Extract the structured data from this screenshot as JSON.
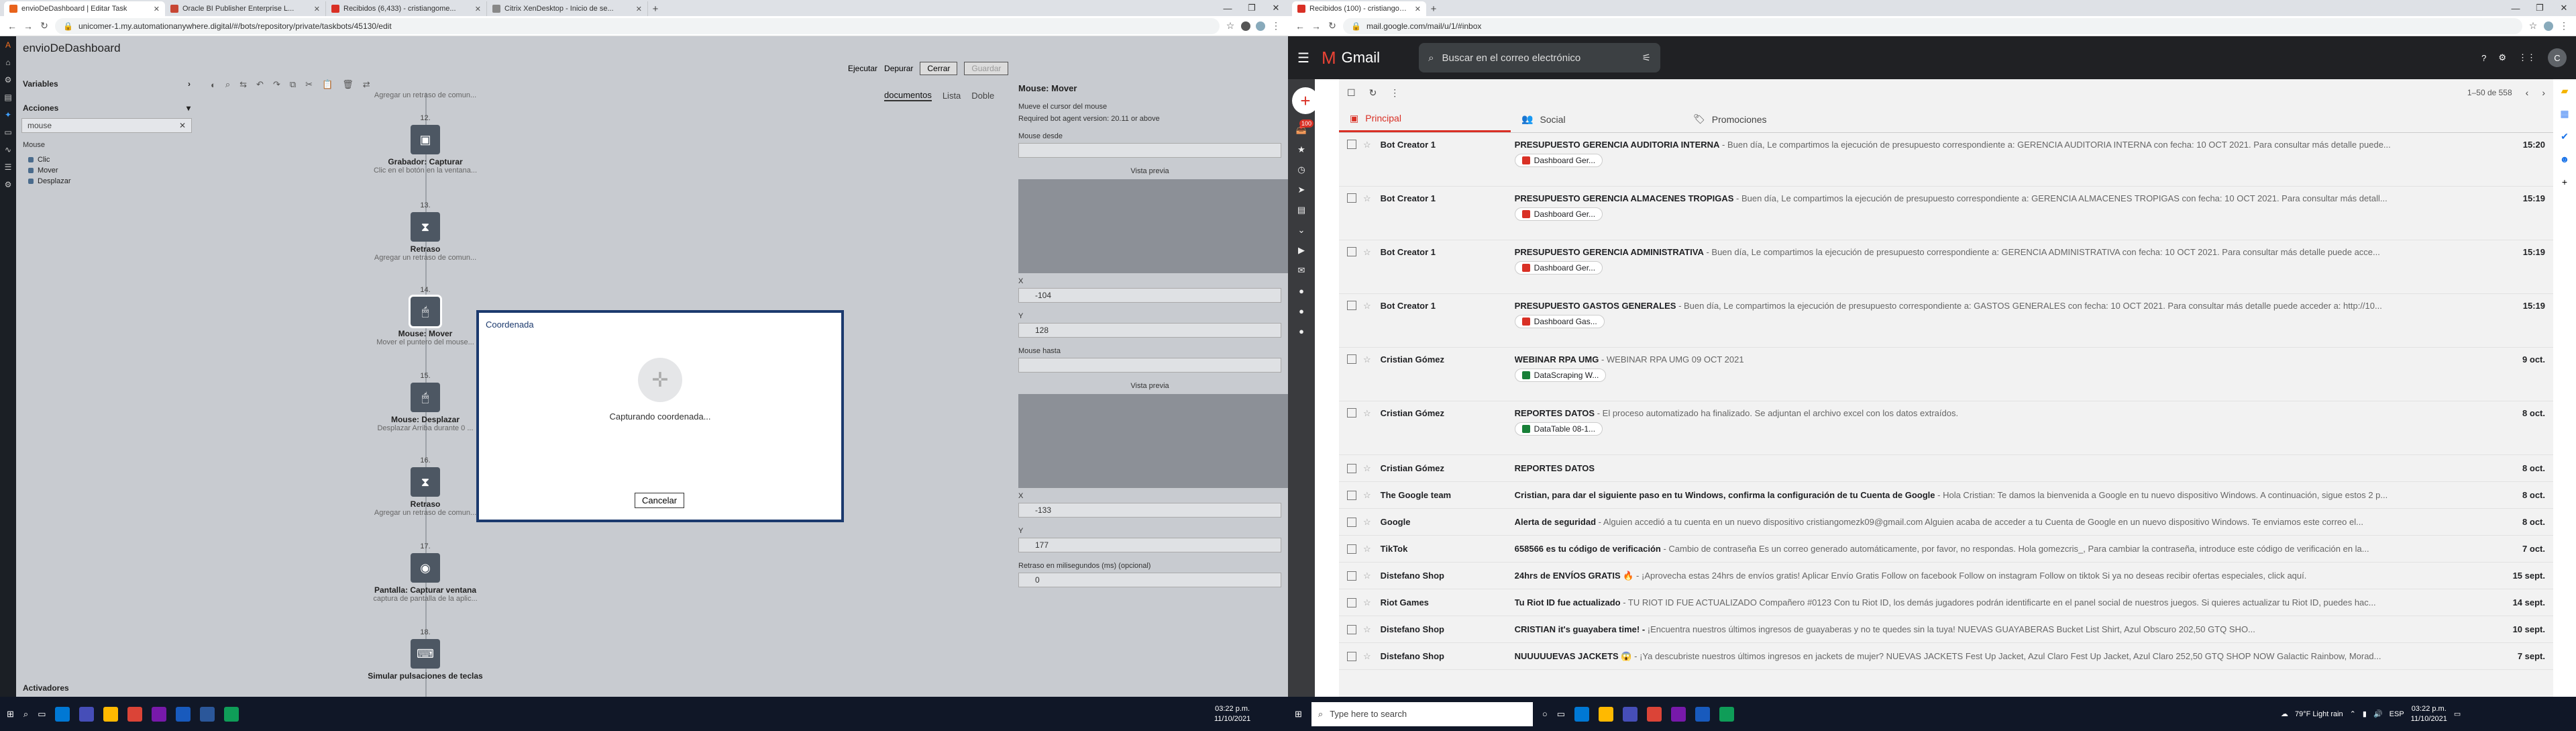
{
  "left_window": {
    "tabs": [
      {
        "title": "envioDeDashboard | Editar Task",
        "active": true
      },
      {
        "title": "Oracle BI Publisher Enterprise L...",
        "active": false
      },
      {
        "title": "Recibidos (6,433) - cristiangome...",
        "active": false
      },
      {
        "title": "Citrix XenDesktop - Inicio de se...",
        "active": false
      }
    ],
    "url": "unicomer-1.my.automationanywhere.digital/#/bots/repository/private/taskbots/45130/edit",
    "app_title": "envioDeDashboard",
    "toolbar": {
      "run": "Ejecutar",
      "debug": "Depurar",
      "cancel": "Cerrar",
      "save": "Guardar"
    },
    "sidebar": {
      "variables_label": "Variables",
      "actions_label": "Acciones",
      "search_value": "mouse",
      "group_label": "Mouse",
      "actions": [
        "Clic",
        "Mover",
        "Desplazar"
      ],
      "activators_label": "Activadores"
    },
    "flow_nodes": [
      {
        "num": "",
        "title": "",
        "desc": "Agregar un retraso de comun..."
      },
      {
        "num": "12.",
        "title": "Grabador: Capturar",
        "desc": "Clic en el botón en la ventana..."
      },
      {
        "num": "13.",
        "title": "Retraso",
        "desc": "Agregar un retraso de comun..."
      },
      {
        "num": "14.",
        "title": "Mouse: Mover",
        "desc": "Mover el puntero del mouse..."
      },
      {
        "num": "15.",
        "title": "Mouse: Desplazar",
        "desc": "Desplazar Arriba durante 0 ..."
      },
      {
        "num": "16.",
        "title": "Retraso",
        "desc": "Agregar un retraso de comun..."
      },
      {
        "num": "17.",
        "title": "Pantalla: Capturar ventana",
        "desc": "captura de pantalla de la aplic..."
      },
      {
        "num": "18.",
        "title": "Simular pulsaciones de teclas",
        "desc": ""
      }
    ],
    "right_tabs": [
      "documentos",
      "Lista",
      "Doble"
    ],
    "props": {
      "title": "Mouse: Mover",
      "desc": "Mueve el cursor del mouse",
      "version": "Required bot agent version: 20.11 or above",
      "from_label": "Mouse desde",
      "preview_label": "Vista previa",
      "x_label": "X",
      "x_value": "-104",
      "y_label": "Y",
      "y_value": "128",
      "to_label": "Mouse hasta",
      "x2_value": "-133",
      "y2_value": "177",
      "delay_label": "Retraso en milisegundos (ms) (opcional)",
      "delay_value": "0"
    },
    "modal": {
      "title": "Coordenada",
      "status": "Capturando coordenada...",
      "cancel": "Cancelar"
    }
  },
  "right_window": {
    "tabs": [
      {
        "title": "Recibidos (100) - cristiangomez...",
        "active": true
      }
    ],
    "url": "mail.google.com/mail/u/1/#inbox",
    "search_placeholder": "Buscar en el correo electrónico",
    "pagination": "1–50 de 558",
    "tabs_inbox": [
      "Principal",
      "Social",
      "Promociones"
    ],
    "badge": "100",
    "emails": [
      {
        "sender": "Bot Creator 1",
        "subject": "PRESUPUESTO GERENCIA AUDITORIA INTERNA",
        "snippet": " - Buen día, Le compartimos la ejecución de presupuesto correspondiente a: GERENCIA AUDITORIA INTERNA con fecha: 10 OCT 2021. Para consultar más detalle puede...",
        "date": "15:20",
        "attach": "Dashboard Ger...",
        "attach_color": "#d93025"
      },
      {
        "sender": "Bot Creator 1",
        "subject": "PRESUPUESTO GERENCIA ALMACENES TROPIGAS",
        "snippet": " - Buen día, Le compartimos la ejecución de presupuesto correspondiente a: GERENCIA ALMACENES TROPIGAS con fecha: 10 OCT 2021. Para consultar más detall...",
        "date": "15:19",
        "attach": "Dashboard Ger...",
        "attach_color": "#d93025"
      },
      {
        "sender": "Bot Creator 1",
        "subject": "PRESUPUESTO GERENCIA ADMINISTRATIVA",
        "snippet": " - Buen día, Le compartimos la ejecución de presupuesto correspondiente a: GERENCIA ADMINISTRATIVA con fecha: 10 OCT 2021. Para consultar más detalle puede acce...",
        "date": "15:19",
        "attach": "Dashboard Ger...",
        "attach_color": "#d93025"
      },
      {
        "sender": "Bot Creator 1",
        "subject": "PRESUPUESTO GASTOS GENERALES",
        "snippet": " - Buen día, Le compartimos la ejecución de presupuesto correspondiente a: GASTOS GENERALES con fecha: 10 OCT 2021. Para consultar más detalle puede acceder a: http://10...",
        "date": "15:19",
        "attach": "Dashboard Gas...",
        "attach_color": "#d93025"
      },
      {
        "sender": "Cristian Gómez",
        "subject": "WEBINAR RPA UMG",
        "snippet": " - WEBINAR RPA UMG 09 OCT 2021",
        "date": "9 oct.",
        "attach": "DataScraping W...",
        "attach_color": "#188038"
      },
      {
        "sender": "Cristian Gómez",
        "subject": "REPORTES DATOS",
        "snippet": " - El proceso automatizado ha finalizado. Se adjuntan el archivo excel con los datos extraídos.",
        "date": "8 oct.",
        "attach": "DataTable 08-1...",
        "attach_color": "#188038"
      },
      {
        "sender": "Cristian Gómez",
        "subject": "REPORTES DATOS",
        "snippet": "",
        "date": "8 oct.",
        "attach": "",
        "attach_color": ""
      },
      {
        "sender": "The Google team",
        "subject": "Cristian, para dar el siguiente paso en tu Windows, confirma la configuración de tu Cuenta de Google",
        "snippet": " - Hola Cristian: Te damos la bienvenida a Google en tu nuevo dispositivo Windows. A continuación, sigue estos 2 p...",
        "date": "8 oct.",
        "attach": "",
        "attach_color": ""
      },
      {
        "sender": "Google",
        "subject": "Alerta de seguridad",
        "snippet": " - Alguien accedió a tu cuenta en un nuevo dispositivo cristiangomezk09@gmail.com Alguien acaba de acceder a tu Cuenta de Google en un nuevo dispositivo Windows. Te enviamos este correo el...",
        "date": "8 oct.",
        "attach": "",
        "attach_color": ""
      },
      {
        "sender": "TikTok",
        "subject": "658566 es tu código de verificación",
        "snippet": " - Cambio de contraseña Es un correo generado automáticamente, por favor, no respondas. Hola gomezcris_, Para cambiar la contraseña, introduce este código de verificación en la...",
        "date": "7 oct.",
        "attach": "",
        "attach_color": ""
      },
      {
        "sender": "Distefano Shop",
        "subject": "24hrs de ENVÍOS GRATIS 🔥",
        "snippet": " - ¡Aprovecha estas 24hrs de envíos gratis! Aplicar Envío Gratis Follow on facebook Follow on instagram Follow on tiktok Si ya no deseas recibir ofertas especiales, click aquí.",
        "date": "15 sept.",
        "attach": "",
        "attach_color": ""
      },
      {
        "sender": "Riot Games",
        "subject": "Tu Riot ID fue actualizado",
        "snippet": " - TU RIOT ID FUE ACTUALIZADO Compañero #0123 Con tu Riot ID, los demás jugadores podrán identificarte en el panel social de nuestros juegos. Si quieres actualizar tu Riot ID, puedes hac...",
        "date": "14 sept.",
        "attach": "",
        "attach_color": ""
      },
      {
        "sender": "Distefano Shop",
        "subject": "CRISTIAN it's guayabera time! -",
        "snippet": " ¡Encuentra nuestros últimos ingresos de guayaberas y no te quedes sin la tuya! NUEVAS GUAYABERAS Bucket List Shirt, Azul Obscuro 202,50 GTQ SHO...",
        "date": "10 sept.",
        "attach": "",
        "attach_color": ""
      },
      {
        "sender": "Distefano Shop",
        "subject": "NUUUUUEVAS JACKETS 😱",
        "snippet": " - ¡Ya descubriste nuestros últimos ingresos en jackets de mujer? NUEVAS JACKETS Fest Up Jacket, Azul Claro Fest Up Jacket, Azul Claro 252,50 GTQ SHOP NOW Galactic Rainbow, Morad...",
        "date": "7 sept.",
        "attach": "",
        "attach_color": ""
      }
    ]
  },
  "taskbar": {
    "search_placeholder": "Type here to search",
    "left_time": "03:22 p.m.",
    "left_date": "11/10/2021",
    "weather": "79°F  Light rain",
    "lang": "ESP",
    "right_time": "03:22 p.m.",
    "right_date": "11/10/2021"
  },
  "colors": {
    "gmail_red": "#d93025",
    "aa_dark": "#1b1f25",
    "modal_border": "#1c3a6e",
    "taskbar": "#101727"
  }
}
